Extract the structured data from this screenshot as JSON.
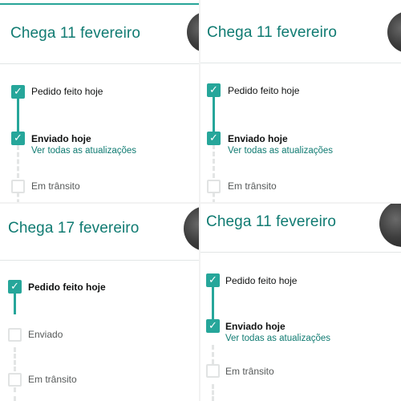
{
  "panels": [
    {
      "title": "Chega 11 fevereiro",
      "steps": [
        {
          "label": "Pedido feito hoje"
        },
        {
          "label": "Enviado hoje",
          "link": "Ver todas as atualizações"
        },
        {
          "label": "Em trânsito"
        }
      ]
    },
    {
      "title": "Chega 11 fevereiro",
      "steps": [
        {
          "label": "Pedido feito hoje"
        },
        {
          "label": "Enviado hoje",
          "link": "Ver todas as atualizações"
        },
        {
          "label": "Em trânsito"
        }
      ]
    },
    {
      "title": "Chega 17 fevereiro",
      "steps": [
        {
          "label": "Pedido feito hoje"
        },
        {
          "label": "Enviado"
        },
        {
          "label": "Em trânsito"
        }
      ]
    },
    {
      "title": "Chega 11 fevereiro",
      "steps": [
        {
          "label": "Pedido feito hoje"
        },
        {
          "label": "Enviado hoje",
          "link": "Ver todas as atualizações"
        },
        {
          "label": "Em trânsito"
        }
      ]
    }
  ],
  "icons": {
    "checked": "checkmark-icon",
    "unchecked": "empty-checkbox-icon",
    "product": "product-thumbnail"
  },
  "colors": {
    "accent": "#26a69a",
    "title": "#107b72",
    "inactive": "#e1e3e3"
  }
}
